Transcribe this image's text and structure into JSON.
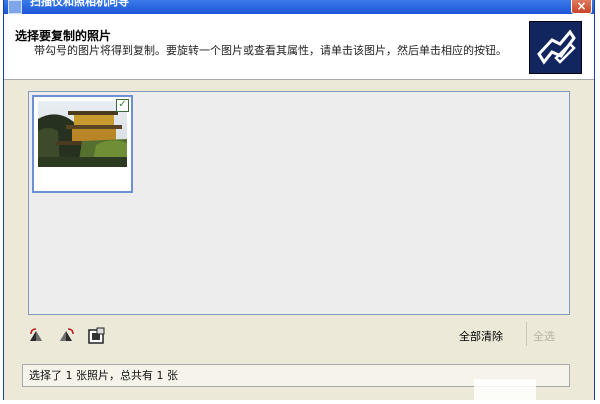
{
  "window": {
    "title": "扫描仪和照相机向导",
    "close_glyph": "×"
  },
  "header": {
    "title": "选择要复制的照片",
    "description": "带勾号的图片将得到复制。要旋转一个图片或查看其属性，请单击该图片，然后单击相应的按钮。"
  },
  "thumbnails": [
    {
      "name": "pagoda-photo",
      "checked": true,
      "check_glyph": "✓"
    }
  ],
  "toolbar": {
    "icons": [
      "rotate-left-icon",
      "rotate-right-icon",
      "properties-icon"
    ],
    "clear_all_label": "全部清除",
    "select_all_label": "全选"
  },
  "status": {
    "text": "选择了 1 张照片，总共有 1 张"
  },
  "colors": {
    "title_bar": "#1c55d6",
    "face": "#ece9d8",
    "selection_border": "#6d8fd6",
    "wizard_art": "#11255e"
  }
}
